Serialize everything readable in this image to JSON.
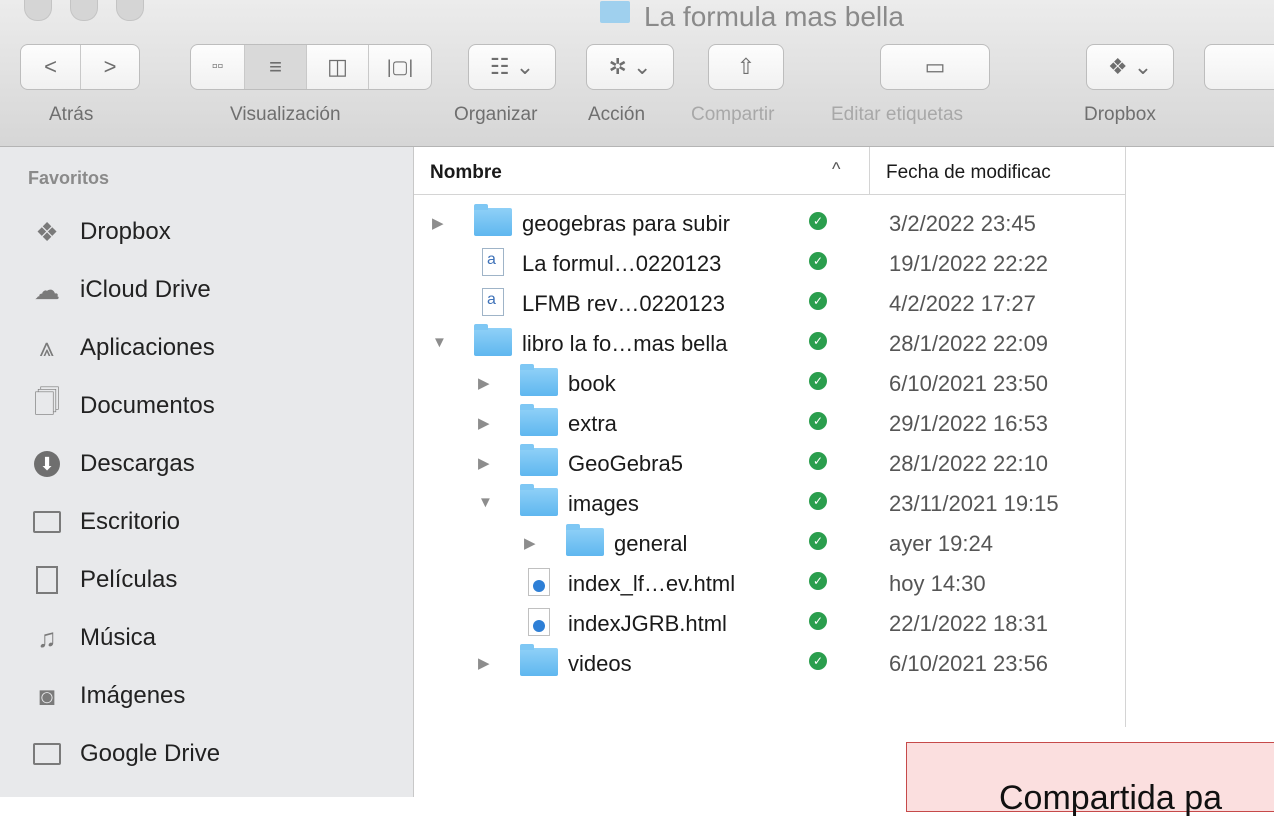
{
  "window": {
    "title": "La formula mas bella"
  },
  "toolbar": {
    "back_label": "Atrás",
    "view_label": "Visualización",
    "organize_label": "Organizar",
    "action_label": "Acción",
    "share_label": "Compartir",
    "tags_label": "Editar etiquetas",
    "dropbox_label": "Dropbox",
    "active_view": "list"
  },
  "sidebar": {
    "header": "Favoritos",
    "items": [
      {
        "label": "Dropbox",
        "icon": "dropbox-icon"
      },
      {
        "label": "iCloud Drive",
        "icon": "cloud-icon"
      },
      {
        "label": "Aplicaciones",
        "icon": "applications-icon"
      },
      {
        "label": "Documentos",
        "icon": "documents-icon"
      },
      {
        "label": "Descargas",
        "icon": "downloads-icon"
      },
      {
        "label": "Escritorio",
        "icon": "desktop-icon"
      },
      {
        "label": "Películas",
        "icon": "movies-icon"
      },
      {
        "label": "Música",
        "icon": "music-icon"
      },
      {
        "label": "Imágenes",
        "icon": "pictures-icon"
      },
      {
        "label": "Google Drive",
        "icon": "folder-icon"
      }
    ]
  },
  "list": {
    "columns": {
      "name": "Nombre",
      "modified": "Fecha de modificac"
    },
    "rows": [
      {
        "name": "geogebras para subir",
        "date": "3/2/2022 23:45",
        "type": "folder",
        "level": 0,
        "disclosure": "collapsed"
      },
      {
        "name": "La formul…0220123",
        "date": "19/1/2022 22:22",
        "type": "document",
        "level": 0,
        "disclosure": "none"
      },
      {
        "name": "LFMB rev…0220123",
        "date": "4/2/2022 17:27",
        "type": "document",
        "level": 0,
        "disclosure": "none"
      },
      {
        "name": "libro la fo…mas bella",
        "date": "28/1/2022 22:09",
        "type": "folder",
        "level": 0,
        "disclosure": "expanded"
      },
      {
        "name": "book",
        "date": "6/10/2021 23:50",
        "type": "folder",
        "level": 1,
        "disclosure": "collapsed"
      },
      {
        "name": "extra",
        "date": "29/1/2022 16:53",
        "type": "folder",
        "level": 1,
        "disclosure": "collapsed"
      },
      {
        "name": "GeoGebra5",
        "date": "28/1/2022 22:10",
        "type": "folder",
        "level": 1,
        "disclosure": "collapsed"
      },
      {
        "name": "images",
        "date": "23/11/2021 19:15",
        "type": "folder",
        "level": 1,
        "disclosure": "expanded"
      },
      {
        "name": "general",
        "date": "ayer 19:24",
        "type": "folder",
        "level": 2,
        "disclosure": "collapsed"
      },
      {
        "name": "index_lf…ev.html",
        "date": "hoy 14:30",
        "type": "html",
        "level": 1,
        "disclosure": "none"
      },
      {
        "name": "indexJGRB.html",
        "date": "22/1/2022 18:31",
        "type": "html",
        "level": 1,
        "disclosure": "none"
      },
      {
        "name": "videos",
        "date": "6/10/2021 23:56",
        "type": "folder",
        "level": 1,
        "disclosure": "collapsed"
      }
    ]
  },
  "popup": {
    "text": "Compartida pa"
  },
  "colors": {
    "sync_check": "#2a9e4d",
    "folder": "#6cbff2",
    "sidebar_bg": "#e8e9eb"
  }
}
